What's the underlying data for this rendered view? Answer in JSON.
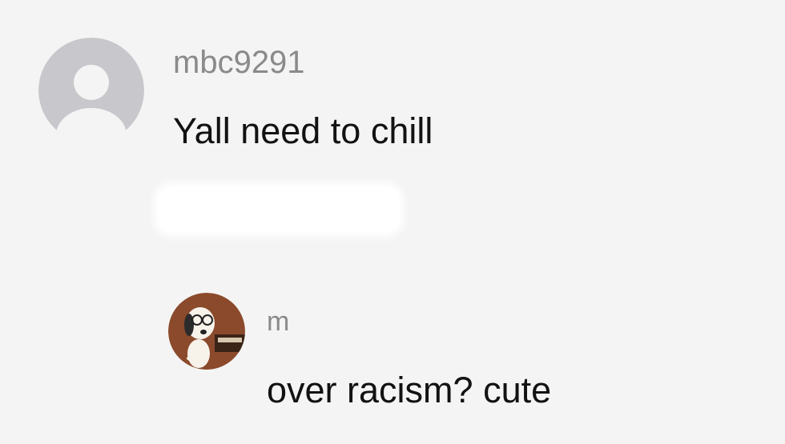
{
  "thread": {
    "parent": {
      "username": "mbc9291",
      "avatar_icon": "default-avatar-icon",
      "text": "Yall need to chill"
    },
    "reply": {
      "username": "m",
      "avatar_icon": "cartoon-dog-avatar-icon",
      "text": "over racism? cute"
    }
  },
  "colors": {
    "background": "#f4f4f4",
    "username": "#8a8a8a",
    "text": "#121212",
    "default_avatar": "#c8c8cc"
  }
}
